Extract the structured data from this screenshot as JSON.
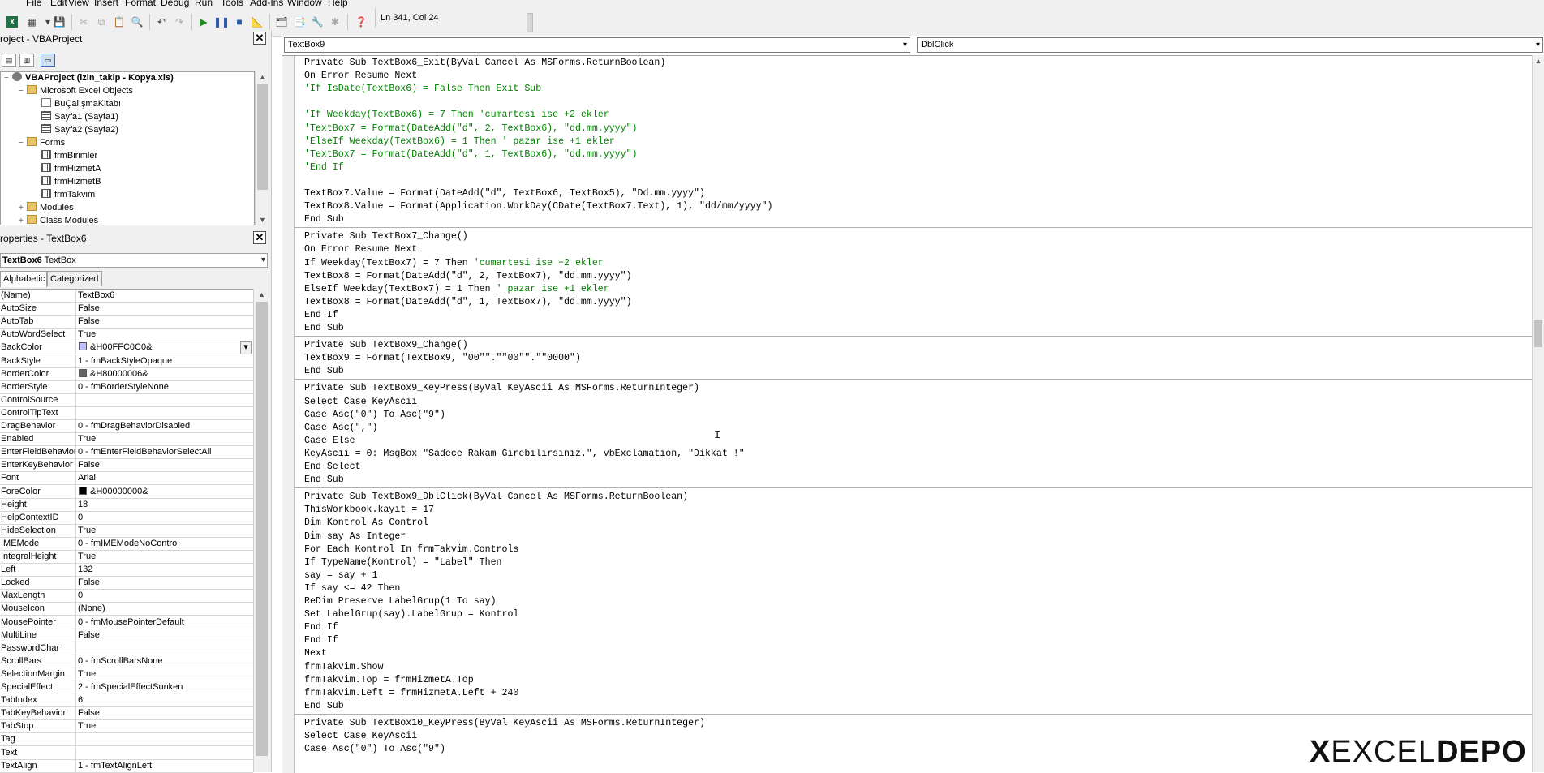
{
  "menu": [
    "File",
    "Edit",
    "View",
    "Insert",
    "Format",
    "Debug",
    "Run",
    "Tools",
    "Add-Ins",
    "Window",
    "Help"
  ],
  "status": "Ln 341, Col 24",
  "project": {
    "title": "roject - VBAProject",
    "tree": [
      {
        "label": "VBAProject (izin_takip - Kopya.xls)",
        "level": 0,
        "icon": "project-icon",
        "bold": true,
        "toggle": "−"
      },
      {
        "label": "Microsoft Excel Objects",
        "level": 1,
        "icon": "folder-icon",
        "toggle": "−"
      },
      {
        "label": "BuÇalışmaKitabı",
        "level": 2,
        "icon": "workbook-icon",
        "toggle": ""
      },
      {
        "label": "Sayfa1 (Sayfa1)",
        "level": 2,
        "icon": "sheet-icon",
        "toggle": ""
      },
      {
        "label": "Sayfa2 (Sayfa2)",
        "level": 2,
        "icon": "sheet-icon",
        "toggle": ""
      },
      {
        "label": "Forms",
        "level": 1,
        "icon": "folder-icon",
        "toggle": "−"
      },
      {
        "label": "frmBirimler",
        "level": 2,
        "icon": "form-icon",
        "toggle": ""
      },
      {
        "label": "frmHizmetA",
        "level": 2,
        "icon": "form-icon",
        "toggle": ""
      },
      {
        "label": "frmHizmetB",
        "level": 2,
        "icon": "form-icon",
        "toggle": ""
      },
      {
        "label": "frmTakvim",
        "level": 2,
        "icon": "form-icon",
        "toggle": ""
      },
      {
        "label": "Modules",
        "level": 1,
        "icon": "folder-icon",
        "toggle": "+"
      },
      {
        "label": "Class Modules",
        "level": 1,
        "icon": "folder-icon",
        "toggle": "+"
      }
    ]
  },
  "properties": {
    "title": "roperties - TextBox6",
    "object_name": "TextBox6",
    "object_type": "TextBox",
    "tabs": [
      "Alphabetic",
      "Categorized"
    ],
    "rows": [
      {
        "name": "(Name)",
        "value": "TextBox6"
      },
      {
        "name": "AutoSize",
        "value": "False"
      },
      {
        "name": "AutoTab",
        "value": "False"
      },
      {
        "name": "AutoWordSelect",
        "value": "True"
      },
      {
        "name": "BackColor",
        "value": "&H00FFC0C0&",
        "swatch": "#c0c0ff",
        "dropdown": true
      },
      {
        "name": "BackStyle",
        "value": "1 - fmBackStyleOpaque"
      },
      {
        "name": "BorderColor",
        "value": "&H80000006&",
        "swatch": "#646464"
      },
      {
        "name": "BorderStyle",
        "value": "0 - fmBorderStyleNone"
      },
      {
        "name": "ControlSource",
        "value": ""
      },
      {
        "name": "ControlTipText",
        "value": ""
      },
      {
        "name": "DragBehavior",
        "value": "0 - fmDragBehaviorDisabled"
      },
      {
        "name": "Enabled",
        "value": "True"
      },
      {
        "name": "EnterFieldBehavior",
        "value": "0 - fmEnterFieldBehaviorSelectAll"
      },
      {
        "name": "EnterKeyBehavior",
        "value": "False"
      },
      {
        "name": "Font",
        "value": "Arial"
      },
      {
        "name": "ForeColor",
        "value": "&H00000000&",
        "swatch": "#000000"
      },
      {
        "name": "Height",
        "value": "18"
      },
      {
        "name": "HelpContextID",
        "value": "0"
      },
      {
        "name": "HideSelection",
        "value": "True"
      },
      {
        "name": "IMEMode",
        "value": "0 - fmIMEModeNoControl"
      },
      {
        "name": "IntegralHeight",
        "value": "True"
      },
      {
        "name": "Left",
        "value": "132"
      },
      {
        "name": "Locked",
        "value": "False"
      },
      {
        "name": "MaxLength",
        "value": "0"
      },
      {
        "name": "MouseIcon",
        "value": "(None)"
      },
      {
        "name": "MousePointer",
        "value": "0 - fmMousePointerDefault"
      },
      {
        "name": "MultiLine",
        "value": "False"
      },
      {
        "name": "PasswordChar",
        "value": ""
      },
      {
        "name": "ScrollBars",
        "value": "0 - fmScrollBarsNone"
      },
      {
        "name": "SelectionMargin",
        "value": "True"
      },
      {
        "name": "SpecialEffect",
        "value": "2 - fmSpecialEffectSunken"
      },
      {
        "name": "TabIndex",
        "value": "6"
      },
      {
        "name": "TabKeyBehavior",
        "value": "False"
      },
      {
        "name": "TabStop",
        "value": "True"
      },
      {
        "name": "Tag",
        "value": ""
      },
      {
        "name": "Text",
        "value": ""
      },
      {
        "name": "TextAlign",
        "value": "1 - fmTextAlignLeft"
      }
    ]
  },
  "code": {
    "object_combo": "TextBox9",
    "proc_combo": "DblClick",
    "lines": [
      {
        "t": "Private Sub TextBox6_Exit(ByVal Cancel As MSForms.ReturnBoolean)"
      },
      {
        "t": "On Error Resume Next"
      },
      {
        "t": "'If IsDate(TextBox6) = False Then Exit Sub",
        "c": true
      },
      {
        "t": ""
      },
      {
        "t": "'If Weekday(TextBox6) = 7 Then 'cumartesi ise +2 ekler",
        "c": true
      },
      {
        "t": "'TextBox7 = Format(DateAdd(\"d\", 2, TextBox6), \"dd.mm.yyyy\")",
        "c": true
      },
      {
        "t": "'ElseIf Weekday(TextBox6) = 1 Then ' pazar ise +1 ekler",
        "c": true
      },
      {
        "t": "'TextBox7 = Format(DateAdd(\"d\", 1, TextBox6), \"dd.mm.yyyy\")",
        "c": true
      },
      {
        "t": "'End If",
        "c": true
      },
      {
        "t": ""
      },
      {
        "t": "TextBox7.Value = Format(DateAdd(\"d\", TextBox6, TextBox5), \"Dd.mm.yyyy\")"
      },
      {
        "t": "TextBox8.Value = Format(Application.WorkDay(CDate(TextBox7.Text), 1), \"dd/mm/yyyy\")"
      },
      {
        "t": "End Sub"
      },
      {
        "sep": true
      },
      {
        "t": "Private Sub TextBox7_Change()"
      },
      {
        "t": "On Error Resume Next"
      },
      {
        "t": "If Weekday(TextBox7) = 7 Then 'cumartesi ise +2 ekler",
        "cs": 30
      },
      {
        "t": "TextBox8 = Format(DateAdd(\"d\", 2, TextBox7), \"dd.mm.yyyy\")"
      },
      {
        "t": "ElseIf Weekday(TextBox7) = 1 Then ' pazar ise +1 ekler",
        "cs": 34
      },
      {
        "t": "TextBox8 = Format(DateAdd(\"d\", 1, TextBox7), \"dd.mm.yyyy\")"
      },
      {
        "t": "End If"
      },
      {
        "t": "End Sub"
      },
      {
        "sep": true
      },
      {
        "t": "Private Sub TextBox9_Change()"
      },
      {
        "t": "TextBox9 = Format(TextBox9, \"00\"\".\"\"00\"\".\"\"0000\")"
      },
      {
        "t": "End Sub"
      },
      {
        "sep": true
      },
      {
        "t": "Private Sub TextBox9_KeyPress(ByVal KeyAscii As MSForms.ReturnInteger)"
      },
      {
        "t": "Select Case KeyAscii"
      },
      {
        "t": "Case Asc(\"0\") To Asc(\"9\")"
      },
      {
        "t": "Case Asc(\",\")"
      },
      {
        "t": "Case Else"
      },
      {
        "t": "KeyAscii = 0: MsgBox \"Sadece Rakam Girebilirsiniz.\", vbExclamation, \"Dikkat !\""
      },
      {
        "t": "End Select"
      },
      {
        "t": "End Sub"
      },
      {
        "sep": true
      },
      {
        "t": "Private Sub TextBox9_DblClick(ByVal Cancel As MSForms.ReturnBoolean)"
      },
      {
        "t": "ThisWorkbook.kayıt = 17"
      },
      {
        "t": "Dim Kontrol As Control"
      },
      {
        "t": "Dim say As Integer"
      },
      {
        "t": "For Each Kontrol In frmTakvim.Controls"
      },
      {
        "t": "If TypeName(Kontrol) = \"Label\" Then"
      },
      {
        "t": "say = say + 1"
      },
      {
        "t": "If say <= 42 Then"
      },
      {
        "t": "ReDim Preserve LabelGrup(1 To say)"
      },
      {
        "t": "Set LabelGrup(say).LabelGrup = Kontrol"
      },
      {
        "t": "End If"
      },
      {
        "t": "End If"
      },
      {
        "t": "Next"
      },
      {
        "t": "frmTakvim.Show"
      },
      {
        "t": "frmTakvim.Top = frmHizmetA.Top"
      },
      {
        "t": "frmTakvim.Left = frmHizmetA.Left + 240"
      },
      {
        "t": "End Sub"
      },
      {
        "sep": true
      },
      {
        "t": "Private Sub TextBox10_KeyPress(ByVal KeyAscii As MSForms.ReturnInteger)"
      },
      {
        "t": "Select Case KeyAscii"
      },
      {
        "t": "Case Asc(\"0\") To Asc(\"9\")"
      }
    ]
  },
  "logo": {
    "x": "X",
    "excel": "EXCEL",
    "depo": "DEPO"
  }
}
